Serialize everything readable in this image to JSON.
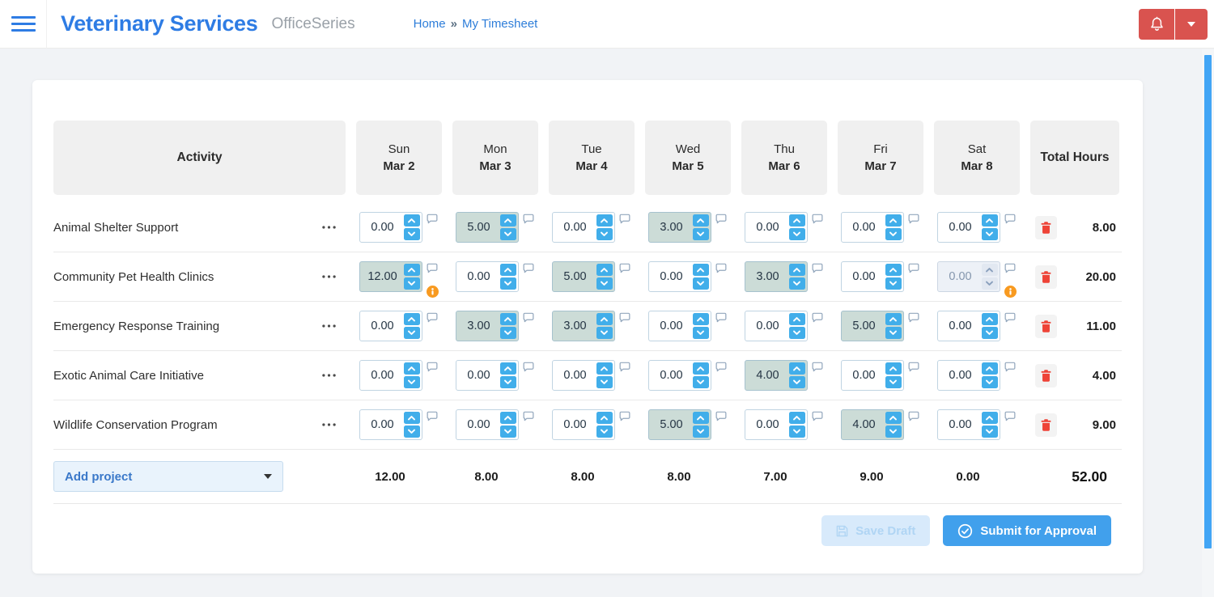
{
  "header": {
    "app_title": "Veterinary Services",
    "suite_name": "OfficeSeries",
    "breadcrumb": {
      "home": "Home",
      "separator": "»",
      "current": "My Timesheet"
    }
  },
  "timesheet": {
    "activity_header": "Activity",
    "total_header": "Total Hours",
    "days": [
      {
        "day": "Sun",
        "date": "Mar 2"
      },
      {
        "day": "Mon",
        "date": "Mar 3"
      },
      {
        "day": "Tue",
        "date": "Mar 4"
      },
      {
        "day": "Wed",
        "date": "Mar 5"
      },
      {
        "day": "Thu",
        "date": "Mar 6"
      },
      {
        "day": "Fri",
        "date": "Mar 7"
      },
      {
        "day": "Sat",
        "date": "Mar 8"
      }
    ],
    "rows": [
      {
        "activity": "Animal Shelter Support",
        "hours": [
          "0.00",
          "5.00",
          "0.00",
          "3.00",
          "0.00",
          "0.00",
          "0.00"
        ],
        "total": "8.00"
      },
      {
        "activity": "Community Pet Health Clinics",
        "hours": [
          "12.00",
          "0.00",
          "5.00",
          "0.00",
          "3.00",
          "0.00",
          "0.00"
        ],
        "total": "20.00"
      },
      {
        "activity": "Emergency Response Training",
        "hours": [
          "0.00",
          "3.00",
          "3.00",
          "0.00",
          "0.00",
          "5.00",
          "0.00"
        ],
        "total": "11.00"
      },
      {
        "activity": "Exotic Animal Care Initiative",
        "hours": [
          "0.00",
          "0.00",
          "0.00",
          "0.00",
          "4.00",
          "0.00",
          "0.00"
        ],
        "total": "4.00"
      },
      {
        "activity": "Wildlife Conservation Program",
        "hours": [
          "0.00",
          "0.00",
          "0.00",
          "5.00",
          "0.00",
          "4.00",
          "0.00"
        ],
        "total": "9.00"
      }
    ],
    "daily_totals": [
      "12.00",
      "8.00",
      "8.00",
      "8.00",
      "7.00",
      "9.00",
      "0.00"
    ],
    "grand_total": "52.00",
    "add_project_label": "Add project",
    "footer": {
      "save_draft": "Save Draft",
      "submit": "Submit for Approval"
    },
    "annotations": {
      "info_cells": [
        [
          1,
          0
        ],
        [
          1,
          6
        ]
      ],
      "disabled_cells": [
        [
          1,
          6
        ]
      ]
    }
  },
  "icons": {
    "menu-icon": "☰",
    "bell-icon": "🔔",
    "caret-down-icon": "▾",
    "chevron-up-icon": "⌃",
    "chevron-down-icon": "⌄",
    "comment-icon": "💬",
    "info-icon": "ℹ",
    "ellipsis-icon": "⋯",
    "trash-icon": "🗑",
    "save-icon": "💾",
    "check-circle-icon": "✓"
  },
  "colors": {
    "brand_blue": "#2e7ce4",
    "danger_red": "#d9534f",
    "spinner_blue": "#41aeea",
    "filled_cell_bg": "#ccdcd7",
    "warning_orange": "#f89a20",
    "trash_red": "#ee4337",
    "submit_blue": "#41a0ec",
    "save_disabled_bg": "#d8eafb",
    "scrollbar_blue": "#42a5f5",
    "header_card_bg": "#f0f0f0",
    "page_bg": "#f1f3f6"
  }
}
